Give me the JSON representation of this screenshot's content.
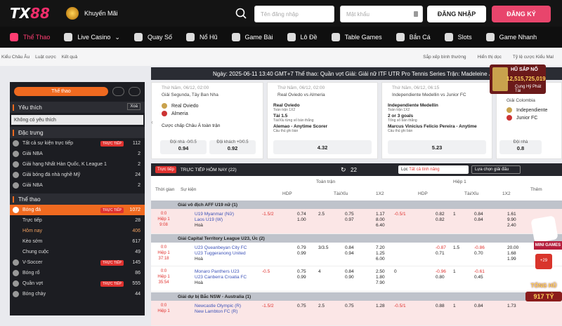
{
  "brand": {
    "logo_left": "TX",
    "logo_right": "88"
  },
  "header": {
    "promo": "Khuyến Mãi",
    "username_placeholder": "Tên đăng nhập",
    "password_placeholder": "Mật khẩu",
    "login": "ĐĂNG NHẬP",
    "register": "ĐĂNG KÝ"
  },
  "nav": [
    "Thể Thao",
    "Live Casino",
    "Quay Số",
    "Nổ Hũ",
    "Game Bài",
    "Lô Đề",
    "Table Games",
    "Bắn Cá",
    "Slots",
    "Game Nhanh"
  ],
  "crumbs": [
    "Kiểu Châu Âu",
    "Luật cược",
    "Kết quả"
  ],
  "crumb_right": [
    "Sắp xếp bình thường",
    "Hiển thị dọc",
    "Tỷ lệ cược Kiểu Mal"
  ],
  "ticker": "Ngày: 2025-06-11 13:40 GMT+7 Thể thao: Quần vợt Giải: Giải nữ ITF UTR Pro Tennis Series Trận: Madeleine Jessup vs K",
  "sidebar": {
    "sport_btn": "Thể thao",
    "fav_title": "Yêu thích",
    "fav_clear": "Xoá",
    "fav_empty": "Không có yêu thích",
    "special_title": "Đặc trưng",
    "special": [
      {
        "label": "Tất cả sự kiện trực tiếp",
        "tag": "TRỰC TIẾP",
        "n": "112"
      },
      {
        "label": "Giải NBA",
        "n": "2"
      },
      {
        "label": "Giải hạng Nhất Hàn Quốc, K League 1",
        "n": "2"
      },
      {
        "label": "Giải bóng đá nhà nghề Mỹ",
        "n": "24"
      },
      {
        "label": "Giải NBA",
        "n": "2"
      }
    ],
    "sports_title": "Thể thao",
    "sports": [
      {
        "label": "Bóng đá",
        "tag": "TRỰC TIẾP",
        "n": "1072",
        "hi": true
      },
      {
        "label": "Trực tiếp",
        "n": "28",
        "sub": true
      },
      {
        "label": "Hôm nay",
        "n": "406",
        "sub": true,
        "orange": true
      },
      {
        "label": "Kèo sớm",
        "n": "617",
        "sub": true
      },
      {
        "label": "Chung cuộc",
        "n": "49",
        "sub": true
      },
      {
        "label": "V-Soccer",
        "tag": "TRỰC TIẾP",
        "n": "145"
      },
      {
        "label": "Bóng rổ",
        "n": "86"
      },
      {
        "label": "Quần vợt",
        "tag": "TRỰC TIẾP",
        "n": "555"
      },
      {
        "label": "Bóng chày",
        "n": "44"
      }
    ]
  },
  "cards": [
    {
      "date": "Thứ Năm, 06/12, 02:00",
      "league": "Giải Segunda, Tây Ban Nha",
      "home": "Real Oviedo",
      "away": "Almeria",
      "market": "Cược chấp Châu Á toàn trận",
      "o1l": "Đội nhà -0/0.5",
      "o1": "0.94",
      "o2l": "Đội khách +0/0.5",
      "o2": "0.92"
    },
    {
      "date": "Thứ Năm, 06/12, 02:00",
      "home": "Real Oviedo",
      "away": "Almeria",
      "m1": "Real Oviedo",
      "m1s": "Toàn trận 1X2",
      "m2": "Tài 1.5",
      "m2s": "Tài/Xỉu từng số bàn thắng",
      "m3": "Alemao - Anytime Scorer",
      "m3s": "Cầu thủ ghi bàn",
      "odds": "4.32"
    },
    {
      "date": "Thứ Năm, 06/12, 06:15",
      "home": "Independiente Medellin",
      "away": "Junior FC",
      "m1": "Independiente Medellin",
      "m1s": "Toàn trận 1X2",
      "m2": "2 or 3 goals",
      "m2s": "Tổng số bàn thắng",
      "m3": "Marcus Vinicius Felicio Pereira - Anytime",
      "m3s": "Cầu thủ ghi bàn",
      "odds": "5.23"
    },
    {
      "league": "Giải Colombia",
      "home": "Independiente",
      "away": "Junior FC",
      "o1l": "Đội nhà",
      "o1": "0.8"
    }
  ],
  "jackpot": {
    "title": "HŨ SẮP NỔ",
    "amount": "12,515,725,019",
    "sub": "Cung Hỷ Phát Tài"
  },
  "table": {
    "live": "Trực tiếp",
    "title": "TRỰC TIẾP HÔM NAY (22)",
    "count": "22",
    "league_filter": "Tất cả tính năng",
    "choose": "Lựa chọn giải đấu",
    "h_time": "Thời gian",
    "h_event": "Sự kiện",
    "h_full": "Toàn trận",
    "h_half": "Hiệp 1",
    "h_hdp": "HDP",
    "h_ou": "Tài/Xỉu",
    "h_1x2": "1X2",
    "h_more": "Thêm",
    "leagues": [
      "Giải vô địch AFF U19 nữ (1)",
      "Giải Capital Territory League U23, Úc (2)",
      "Giải dự bị Bắc NSW - Australia (1)"
    ],
    "matches": [
      {
        "score": "0:0",
        "period": "Hiệp 1",
        "clock": "9:08",
        "home": "U19 Myanmar (Nữ)",
        "away": "Laos U19 (W)",
        "draw": "Hoà",
        "hdp": "-1.5/2",
        "h1": "0.74",
        "h2": "1.00",
        "ou": "2.5",
        "o1": "0.75",
        "o2": "0.97",
        "u": "u",
        "x1": "1.17",
        "x2": "8.00",
        "x3": "6.40",
        "hh": "-0.5/1",
        "hh1": "0.82",
        "hh2": "0.82",
        "hu": "1",
        "hu1": "0.84",
        "hu2": "0.84",
        "hx1": "1.61",
        "hx2": "9.90",
        "hx3": "2.40"
      },
      {
        "score": "0:0",
        "period": "Hiệp 1",
        "clock": "37:18",
        "home": "U23 Queanbeyan City FC",
        "away": "U23 Tuggeranong United",
        "draw": "Hoà",
        "h1": "0.79",
        "h2": "0.99",
        "ou": "3/3.5",
        "o1": "0.84",
        "o2": "0.94",
        "x1": "7.20",
        "x2": "1.25",
        "x3": "6.00",
        "hh1": "-0.87",
        "hh2": "0.71",
        "hu": "1.5",
        "hu1": "-0.86",
        "hu2": "0.70",
        "hx1": "20.00",
        "hx2": "1.68",
        "hx3": "1.99"
      },
      {
        "score": "0:0",
        "period": "Hiệp 1",
        "clock": "35:54",
        "home": "Monaro Panthers U23",
        "away": "U23 Canberra Croatia FC",
        "draw": "Hoà",
        "hdp": "-0.5",
        "h1": "0.75",
        "h2": "0.99",
        "ou": "4",
        "o1": "0.84",
        "o2": "0.90",
        "x1": "2.50",
        "x2": "1.80",
        "x3": "7.90",
        "hh": "0",
        "hh1": "-0.96",
        "hh2": "0.80",
        "hu": "1",
        "hu1": "-0.61",
        "hu2": "0.45",
        "hx1": "",
        "hx2": "",
        "hx3": ""
      },
      {
        "score": "0:0",
        "period": "Hiệp 1",
        "clock": "",
        "home": "Newcastle Olympic (R)",
        "away": "New Lambton FC (R)",
        "draw": "",
        "hdp": "-1.5/2",
        "h1": "0.75",
        "h2": "",
        "ou": "2.5",
        "o1": "0.75",
        "o2": "",
        "x1": "1.28",
        "x2": "",
        "x3": "",
        "hh": "-0.5/1",
        "hh1": "0.88",
        "hh2": "",
        "hu": "1",
        "hu1": "0.84",
        "hu2": "",
        "hx1": "1.73",
        "hx2": "",
        "hx3": ""
      }
    ]
  },
  "games": {
    "mini": "MINI GAMES",
    "tong": "TỔNG HŨ",
    "amount": "917 TỶ",
    "plus": "+29"
  }
}
